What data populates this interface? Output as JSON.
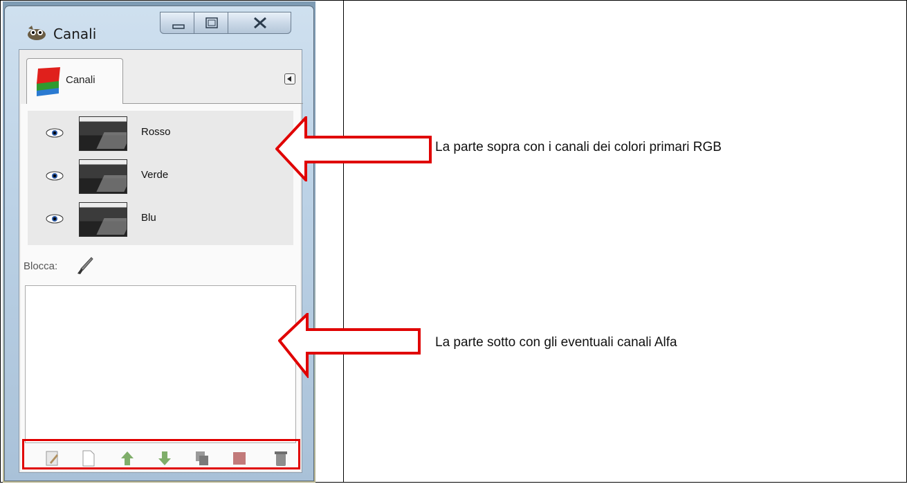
{
  "window": {
    "title": "Canali",
    "app_icon": "gimp-wilber-icon",
    "controls": [
      "minimize-icon",
      "maximize-icon",
      "close-icon"
    ]
  },
  "dock": {
    "tab_label": "Canali",
    "tab_icon": "channels-stack-icon",
    "tab_menu_icon": "tab-menu-arrow-icon"
  },
  "channels": [
    {
      "name": "Rosso",
      "visible": true
    },
    {
      "name": "Verde",
      "visible": true
    },
    {
      "name": "Blu",
      "visible": true
    }
  ],
  "lock": {
    "label": "Blocca:",
    "icon": "paintbrush-lock-icon"
  },
  "toolbar_icons": [
    "edit-channel-icon",
    "new-channel-icon",
    "raise-channel-icon",
    "lower-channel-icon",
    "duplicate-channel-icon",
    "channel-to-selection-icon",
    "delete-channel-icon"
  ],
  "annotations": {
    "top": "La parte sopra con i canali dei colori primari RGB",
    "bottom": "La parte sotto con gli eventuali canali Alfa",
    "color": "#e00000"
  }
}
